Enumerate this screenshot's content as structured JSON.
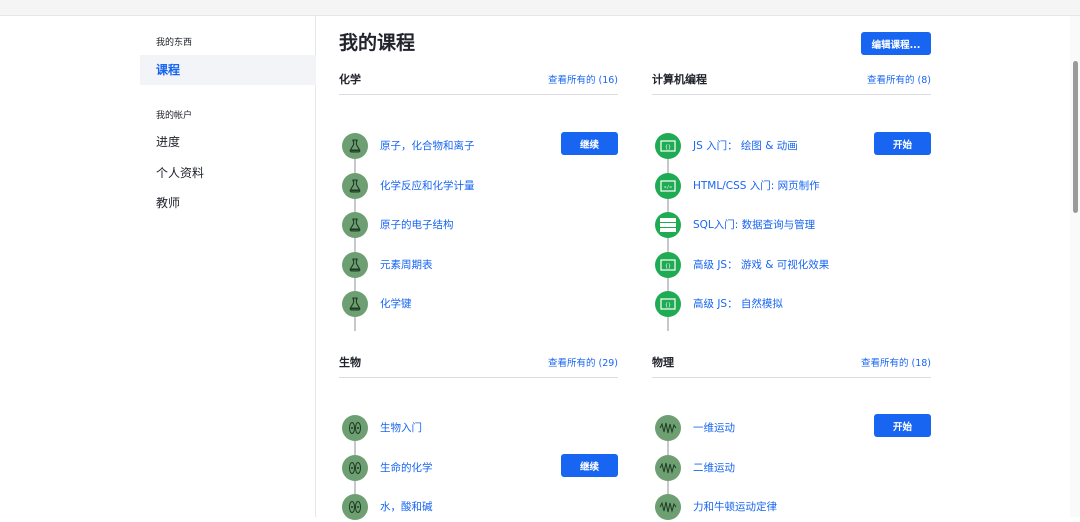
{
  "sidebar": {
    "section_mine": "我的东西",
    "courses": "课程",
    "section_account": "我的帐户",
    "progress": "进度",
    "profile": "个人资料",
    "teachers": "教师"
  },
  "main": {
    "title": "我的课程",
    "edit_button": "编辑课程..."
  },
  "sections": [
    {
      "title": "化学",
      "link": "查看所有的 (16)",
      "icon": "flask-icon",
      "courses": [
        {
          "name": "原子，化合物和离子",
          "button": "继续"
        },
        {
          "name": "化学反应和化学计量"
        },
        {
          "name": "原子的电子结构"
        },
        {
          "name": "元素周期表"
        },
        {
          "name": "化学键"
        }
      ]
    },
    {
      "title": "计算机编程",
      "link": "查看所有的 (8)",
      "courses": [
        {
          "name": "JS 入门： 绘图 & 动画",
          "button": "开始",
          "icon": "code-window-icon"
        },
        {
          "name": "HTML/CSS 入门: 网页制作",
          "icon": "html-tag-icon"
        },
        {
          "name": "SQL入门: 数据查询与管理",
          "icon": "database-icon"
        },
        {
          "name": "高级 JS： 游戏 & 可视化效果",
          "icon": "code-window-icon"
        },
        {
          "name": "高级 JS： 自然模拟",
          "icon": "code-window-icon"
        }
      ]
    },
    {
      "title": "生物",
      "link": "查看所有的 (29)",
      "icon": "cells-icon",
      "courses": [
        {
          "name": "生物入门"
        },
        {
          "name": "生命的化学",
          "button": "继续"
        },
        {
          "name": "水，酸和碱"
        }
      ]
    },
    {
      "title": "物理",
      "link": "查看所有的 (18)",
      "icon": "wave-icon",
      "courses": [
        {
          "name": "一维运动",
          "button": "开始"
        },
        {
          "name": "二维运动"
        },
        {
          "name": "力和牛顿运动定律"
        }
      ]
    }
  ]
}
